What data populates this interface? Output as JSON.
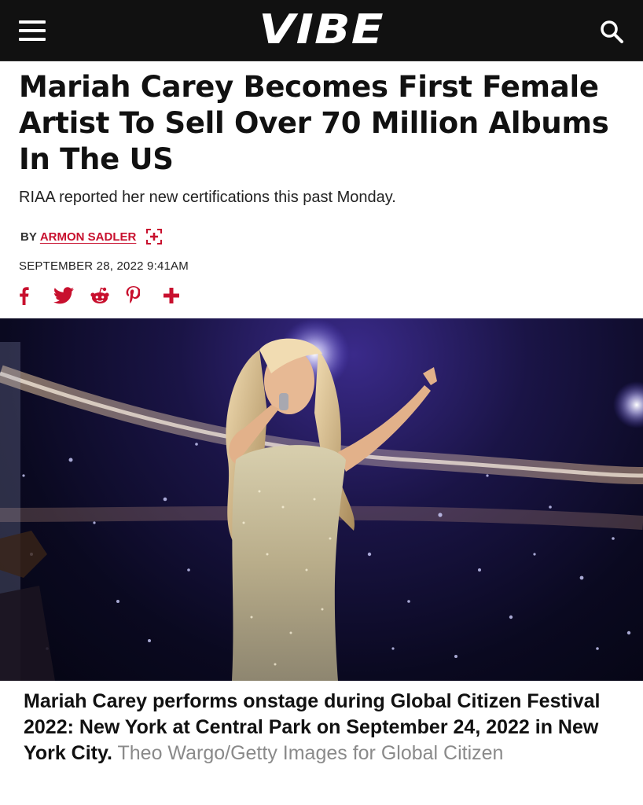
{
  "header": {
    "logo": "VIBE",
    "menu_icon": "hamburger-menu-icon",
    "search_icon": "search-icon",
    "background": "#111111"
  },
  "article": {
    "headline": "Mariah Carey Becomes First Female Artist To Sell Over 70 Million Albums In The US",
    "dek": "RIAA reported her new certifications this past Monday.",
    "byline_prefix": "BY",
    "author": "ARMON SADLER",
    "date": "SEPTEMBER 28, 2022 9:41AM",
    "accent_color": "#c8102e"
  },
  "share": {
    "icons": [
      "facebook-icon",
      "twitter-icon",
      "reddit-icon",
      "pinterest-icon",
      "more-share-icon"
    ]
  },
  "image": {
    "caption": "Mariah Carey performs onstage during Global Citizen Festival 2022: New York at Central Park on September 24, 2022 in New York City.",
    "credit": "Theo Wargo/Getty Images for Global Citizen"
  }
}
